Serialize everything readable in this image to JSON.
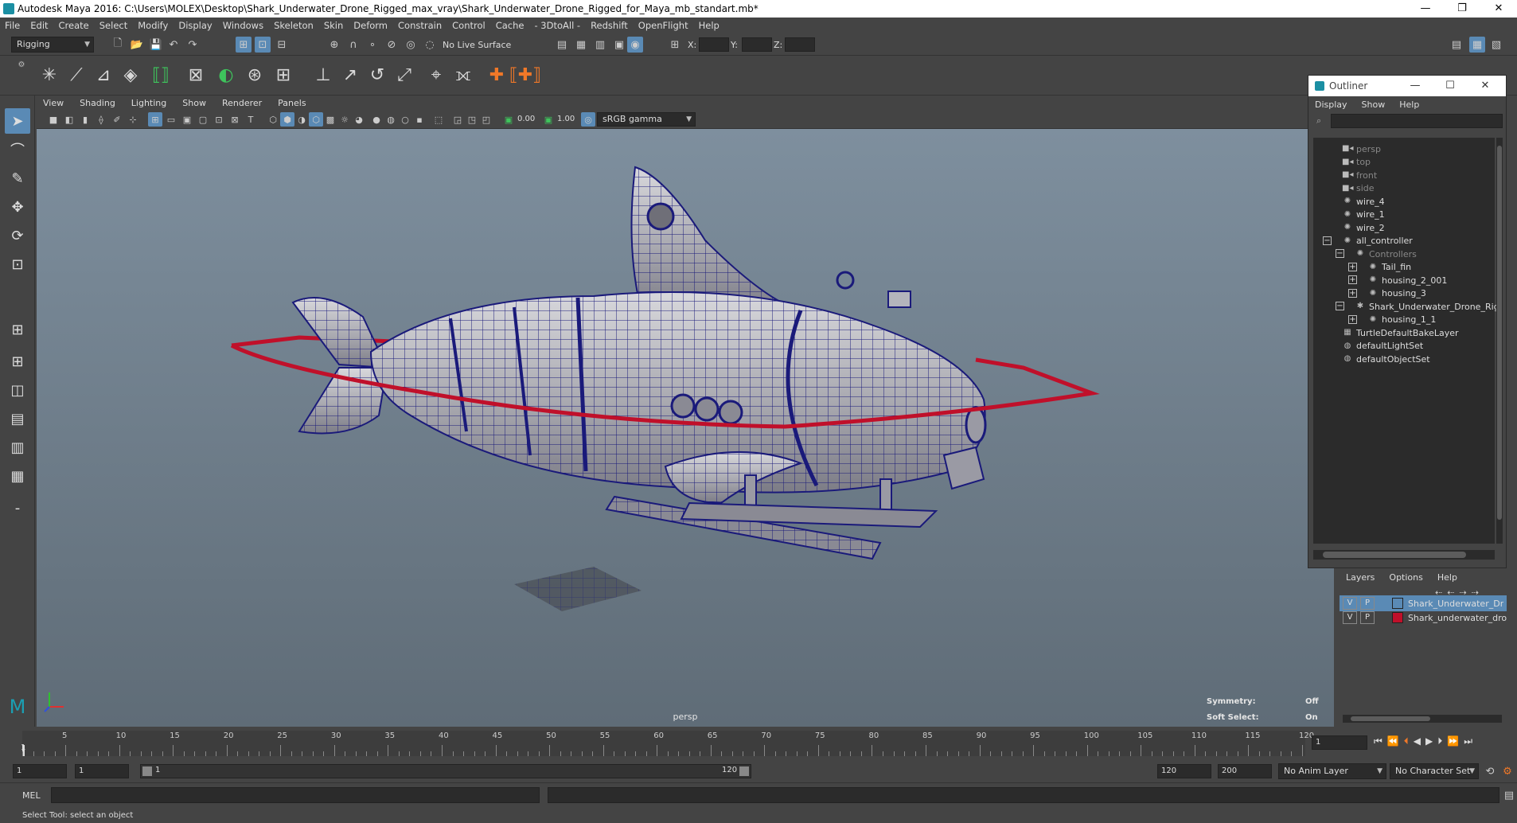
{
  "window": {
    "title": "Autodesk Maya 2016: C:\\Users\\MOLEX\\Desktop\\Shark_Underwater_Drone_Rigged_max_vray\\Shark_Underwater_Drone_Rigged_for_Maya_mb_standart.mb*",
    "minimize": "—",
    "restore": "❐",
    "close": "✕"
  },
  "menubar": [
    "File",
    "Edit",
    "Create",
    "Select",
    "Modify",
    "Display",
    "Windows",
    "Skeleton",
    "Skin",
    "Deform",
    "Constrain",
    "Control",
    "Cache",
    "- 3DtoAll -",
    "Redshift",
    "OpenFlight",
    "Help"
  ],
  "status": {
    "menuset": "Rigging",
    "live_surface": "No Live Surface",
    "x_label": "X:",
    "y_label": "Y:",
    "z_label": "Z:"
  },
  "panel": {
    "menus": [
      "View",
      "Shading",
      "Lighting",
      "Show",
      "Renderer",
      "Panels"
    ],
    "exposure": "0.00",
    "gamma": "1.00",
    "colorspace": "sRGB gamma"
  },
  "viewport": {
    "camera_label": "persp",
    "symmetry_label": "Symmetry:",
    "symmetry_value": "Off",
    "softselect_label": "Soft Select:",
    "softselect_value": "On"
  },
  "outliner": {
    "title": "Outliner",
    "menus": [
      "Display",
      "Show",
      "Help"
    ],
    "items": [
      {
        "label": "persp",
        "indent": 0,
        "icon": "camera",
        "dim": true,
        "exp": ""
      },
      {
        "label": "top",
        "indent": 0,
        "icon": "camera",
        "dim": true,
        "exp": ""
      },
      {
        "label": "front",
        "indent": 0,
        "icon": "camera",
        "dim": true,
        "exp": ""
      },
      {
        "label": "side",
        "indent": 0,
        "icon": "camera",
        "dim": true,
        "exp": ""
      },
      {
        "label": "wire_4",
        "indent": 0,
        "icon": "curve",
        "dim": false,
        "exp": ""
      },
      {
        "label": "wire_1",
        "indent": 0,
        "icon": "curve",
        "dim": false,
        "exp": ""
      },
      {
        "label": "wire_2",
        "indent": 0,
        "icon": "curve",
        "dim": false,
        "exp": ""
      },
      {
        "label": "all_controller",
        "indent": 0,
        "icon": "curve",
        "dim": false,
        "exp": "−"
      },
      {
        "label": "Controllers",
        "indent": 1,
        "icon": "curve",
        "dim": true,
        "exp": "−"
      },
      {
        "label": "Tail_fin",
        "indent": 2,
        "icon": "curve",
        "dim": false,
        "exp": "+"
      },
      {
        "label": "housing_2_001",
        "indent": 2,
        "icon": "curve",
        "dim": false,
        "exp": "+"
      },
      {
        "label": "housing_3",
        "indent": 2,
        "icon": "curve",
        "dim": false,
        "exp": "+"
      },
      {
        "label": "Shark_Underwater_Drone_Rig",
        "indent": 1,
        "icon": "joint",
        "dim": false,
        "exp": "−"
      },
      {
        "label": "housing_1_1",
        "indent": 2,
        "icon": "curve",
        "dim": false,
        "exp": "+"
      },
      {
        "label": "TurtleDefaultBakeLayer",
        "indent": 0,
        "icon": "layer",
        "dim": false,
        "exp": ""
      },
      {
        "label": "defaultLightSet",
        "indent": 0,
        "icon": "set",
        "dim": false,
        "exp": ""
      },
      {
        "label": "defaultObjectSet",
        "indent": 0,
        "icon": "set",
        "dim": false,
        "exp": ""
      }
    ]
  },
  "layers": {
    "menus": [
      "Layers",
      "Options",
      "Help"
    ],
    "rows": [
      {
        "v": "V",
        "p": "P",
        "color": "#5a8ab5",
        "name": "Shark_Underwater_Dr",
        "selected": true
      },
      {
        "v": "V",
        "p": "P",
        "color": "#c0102a",
        "name": "Shark_underwater_dro",
        "selected": false
      }
    ]
  },
  "timeline": {
    "ticks": [
      "5",
      "10",
      "15",
      "20",
      "25",
      "30",
      "35",
      "40",
      "45",
      "50",
      "55",
      "60",
      "65",
      "70",
      "75",
      "80",
      "85",
      "90",
      "95",
      "100",
      "105",
      "110",
      "115",
      "120"
    ],
    "start_marker": "1",
    "current_frame": "1"
  },
  "range": {
    "start": "1",
    "anim_start": "1",
    "slider_start": "1",
    "slider_end": "120",
    "anim_end": "120",
    "end": "200",
    "anim_layer": "No Anim Layer",
    "character_set": "No Character Set"
  },
  "cmd": {
    "mode": "MEL"
  },
  "help": {
    "text": "Select Tool: select an object"
  },
  "colors": {
    "accent": "#5a8ab5",
    "wire": "#1a1a7a",
    "controller": "#c0102a"
  }
}
